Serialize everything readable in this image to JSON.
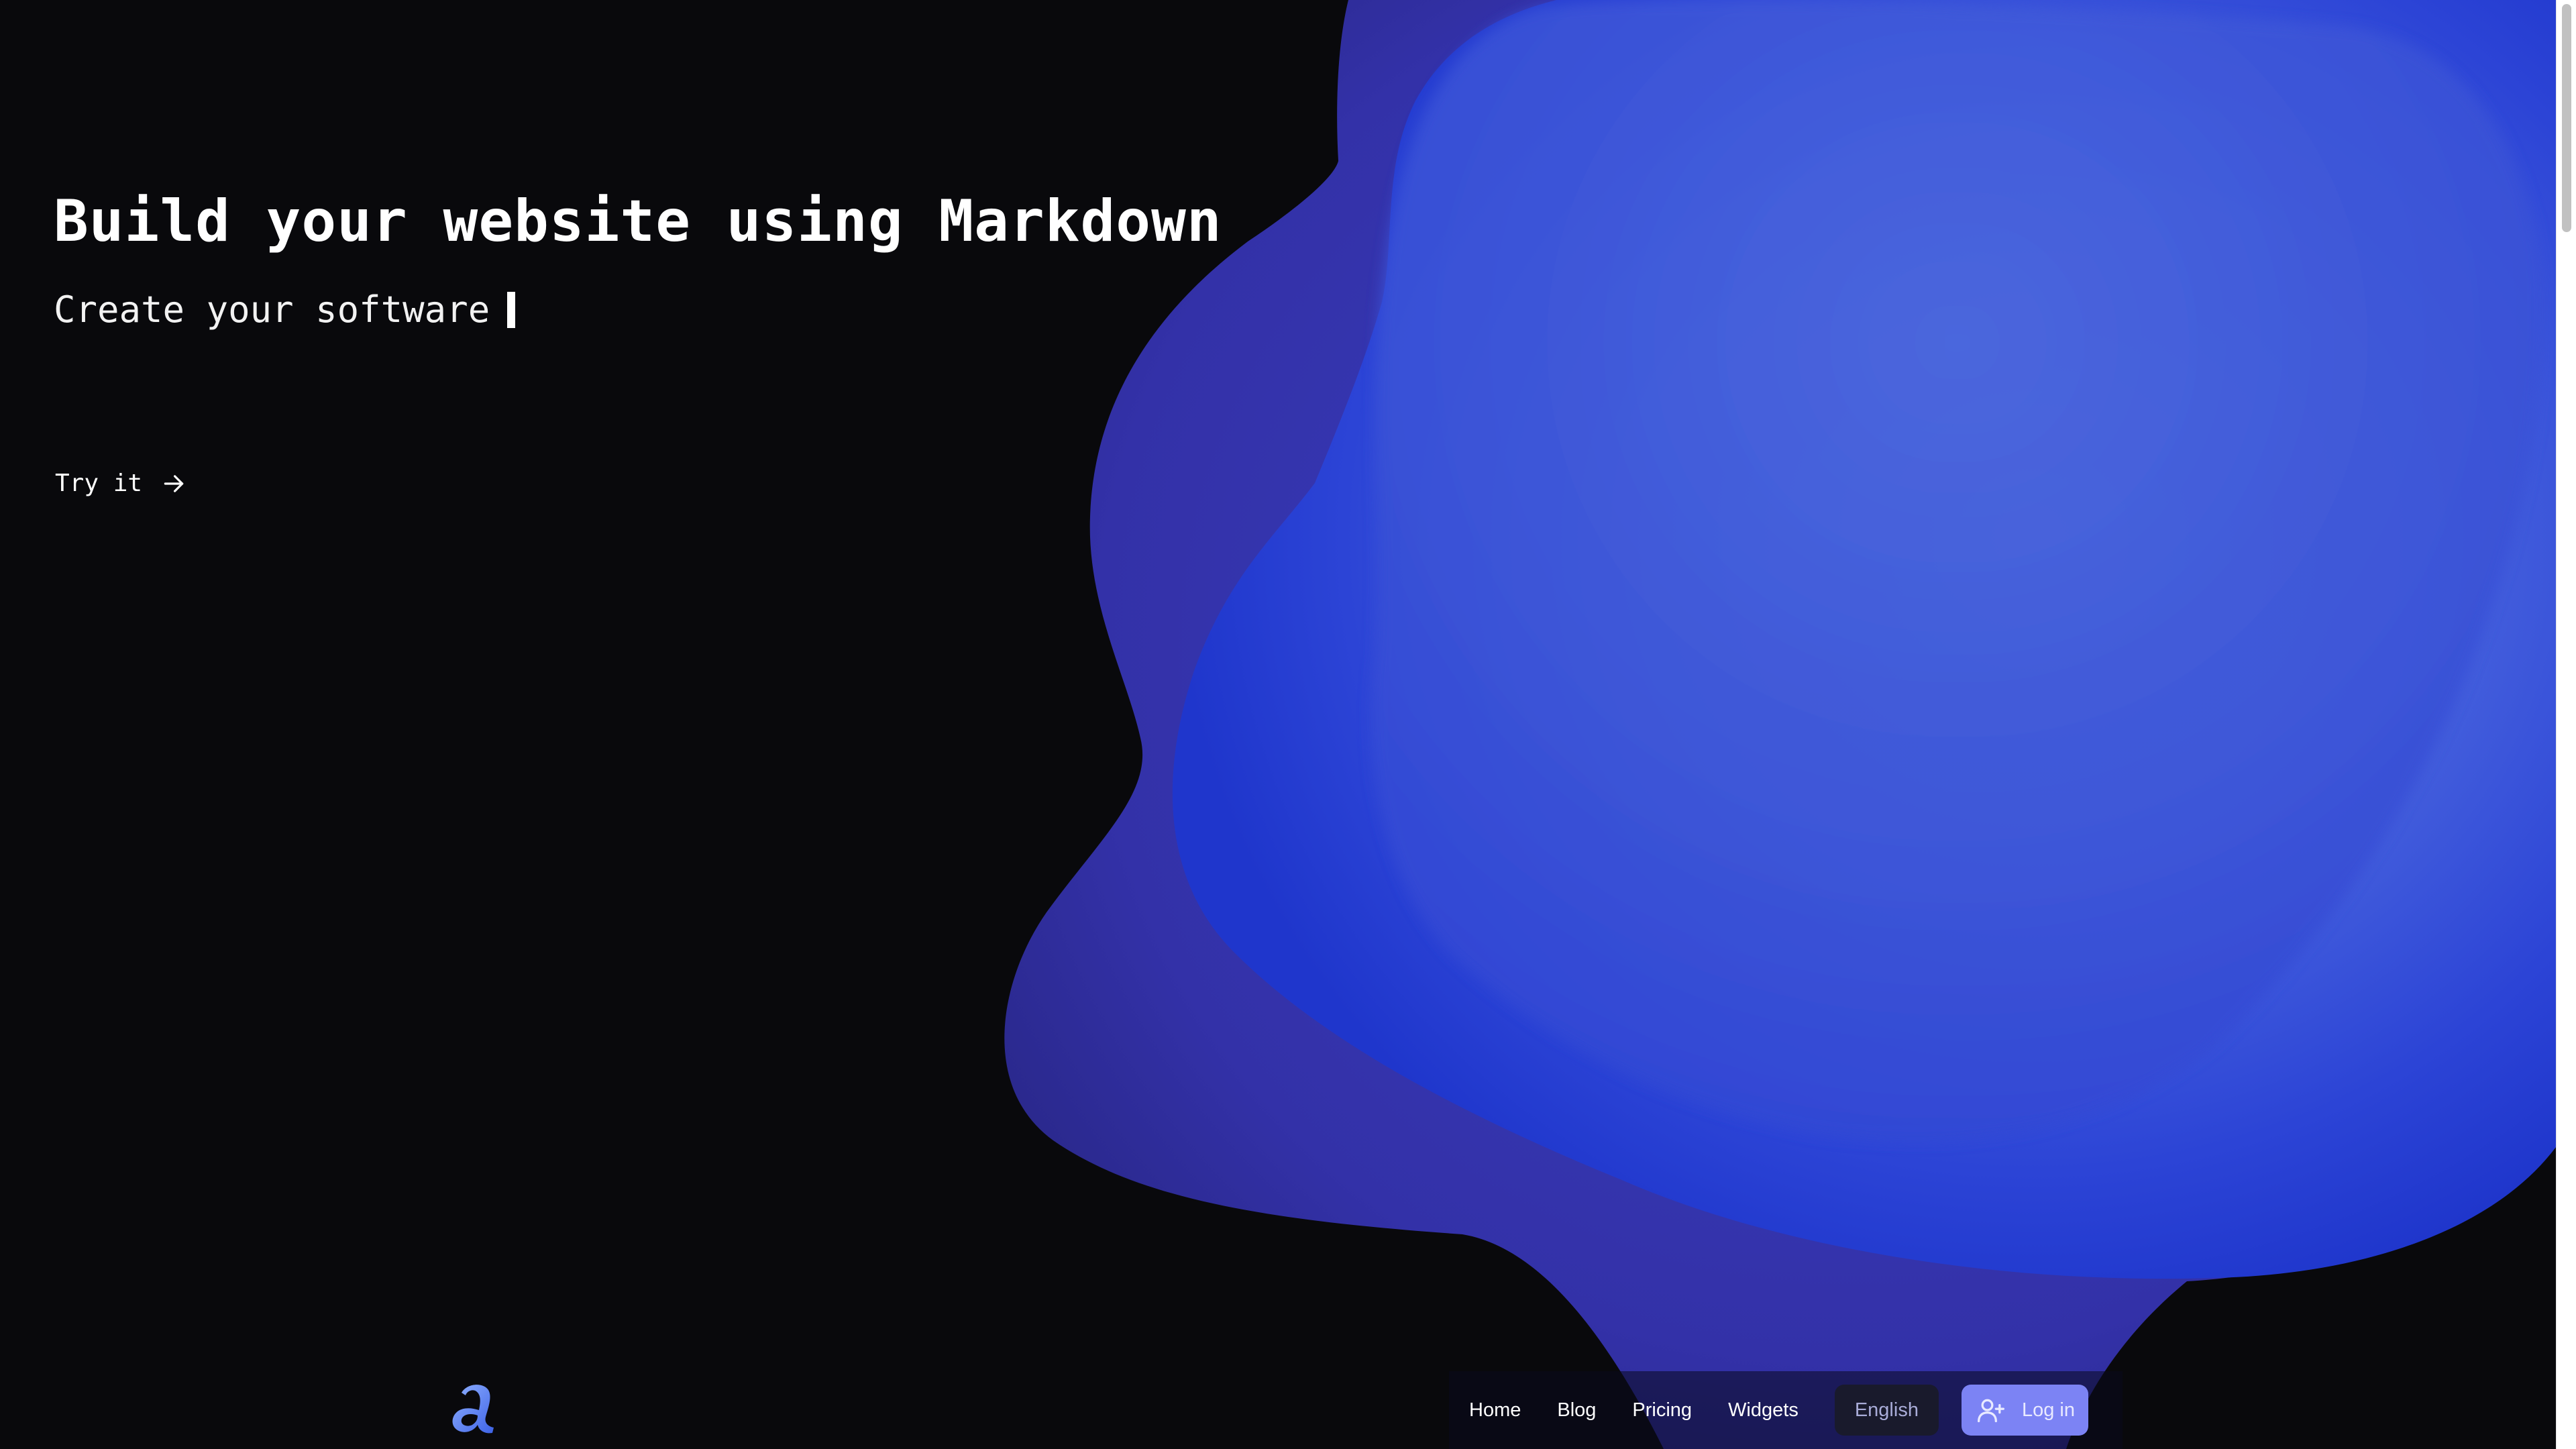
{
  "hero": {
    "title": "Build your website using Markdown",
    "subtitle": "Create your software",
    "cta_label": "Try it"
  },
  "nav": {
    "items": [
      {
        "label": "Home"
      },
      {
        "label": "Blog"
      },
      {
        "label": "Pricing"
      },
      {
        "label": "Widgets"
      }
    ],
    "language": "English",
    "login": "Log in"
  },
  "icons": {
    "logo": "logo-letter-a",
    "cta": "arrow-right-icon",
    "login": "user-plus-icon"
  },
  "colors": {
    "background": "#09090c",
    "blob_outer": "#3433a6",
    "blob_inner": "#2a45d8",
    "login_button": "#7c83f4"
  }
}
